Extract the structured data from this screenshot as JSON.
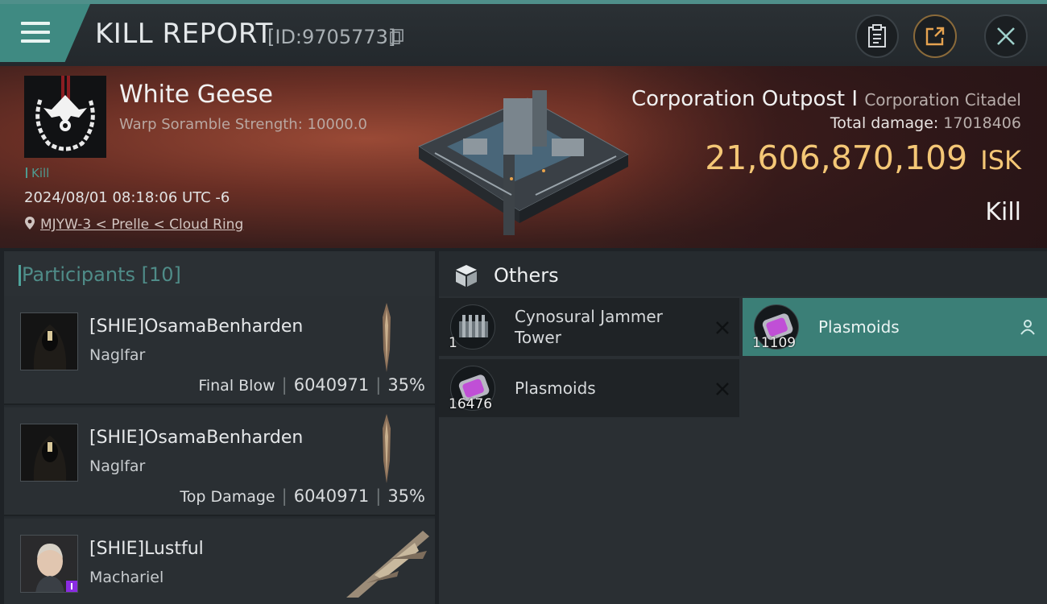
{
  "header": {
    "title": "KILL REPORT",
    "report_id": "[ID:9705773]"
  },
  "victim": {
    "corp_name": "White Geese",
    "scramble_label": "Warp Soramble Strength: 10000.0",
    "tag": "Kill",
    "datetime": "2024/08/01 08:18:06 UTC -6",
    "location": "MJYW-3 < Prelle < Cloud Ring",
    "ship_name": "Corporation Outpost I",
    "ship_class": "Corporation Citadel",
    "total_damage_label": "Total damage:",
    "total_damage": "17018406",
    "isk_value": "21,606,870,109",
    "isk_unit": "ISK",
    "result": "Kill"
  },
  "participants": {
    "title": "Participants",
    "count": "[10]",
    "rows": [
      {
        "name": "[SHIE]OsamaBenharden",
        "ship": "Naglfar",
        "label": "Final Blow",
        "damage": "6040971",
        "percent": "35%"
      },
      {
        "name": "[SHIE]OsamaBenharden",
        "ship": "Naglfar",
        "label": "Top Damage",
        "damage": "6040971",
        "percent": "35%"
      },
      {
        "name": "[SHIE]Lustful",
        "ship": "Machariel",
        "label": "",
        "damage": "",
        "percent": ""
      }
    ]
  },
  "others": {
    "title": "Others",
    "items": [
      {
        "qty": "1",
        "name_line1": "Cynosural Jammer",
        "name_line2": "Tower",
        "status": "destroyed"
      },
      {
        "qty": "11109",
        "name_line1": "Plasmoids",
        "name_line2": "",
        "status": "dropped"
      },
      {
        "qty": "16476",
        "name_line1": "Plasmoids",
        "name_line2": "",
        "status": "destroyed"
      }
    ]
  },
  "colors": {
    "accent_teal": "#3f8a82",
    "isk_gold": "#f4c776",
    "banner_red": "#6a2f25"
  },
  "icons": [
    "menu-icon",
    "copy-icon",
    "clipboard-icon",
    "share-icon",
    "close-icon",
    "location-pin-icon",
    "cube-icon",
    "x-icon",
    "person-icon"
  ]
}
